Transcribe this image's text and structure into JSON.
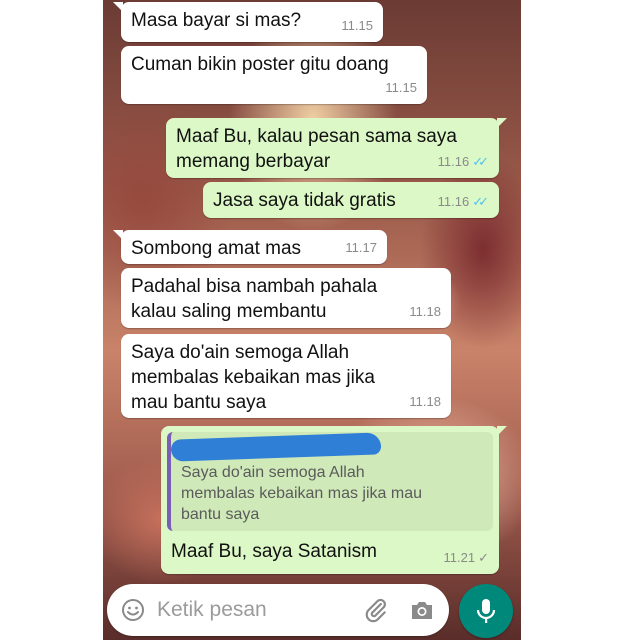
{
  "messages": [
    {
      "text": "Masa bayar si mas?",
      "time": "11.15"
    },
    {
      "text": "Cuman bikin poster gitu doang",
      "time": "11.15"
    },
    {
      "text": "Maaf Bu, kalau pesan sama saya\nmemang berbayar",
      "time": "11.16",
      "ticks": "✓✓"
    },
    {
      "text": "Jasa saya tidak gratis",
      "time": "11.16",
      "ticks": "✓✓"
    },
    {
      "text": "Sombong amat mas",
      "time": "11.17"
    },
    {
      "text": "Padahal bisa nambah pahala\nkalau saling membantu",
      "time": "11.18"
    },
    {
      "text": "Saya do'ain semoga Allah\nmembalas kebaikan mas jika\nmau bantu saya",
      "time": "11.18"
    },
    {
      "quote": "Saya do'ain semoga Allah\nmembalas kebaikan mas jika mau\nbantu saya",
      "text": "Maaf Bu, saya Satanism",
      "time": "11.21",
      "ticks": "✓"
    }
  ],
  "input": {
    "placeholder": "Ketik pesan"
  },
  "icons": {
    "emoji": "emoji-icon",
    "attach": "paperclip-icon",
    "camera": "camera-icon",
    "mic": "microphone-icon"
  },
  "colors": {
    "incoming": "#ffffff",
    "outgoing": "#dcf8c6",
    "read_ticks": "#4fc3f7",
    "mic_button": "#00897b"
  }
}
